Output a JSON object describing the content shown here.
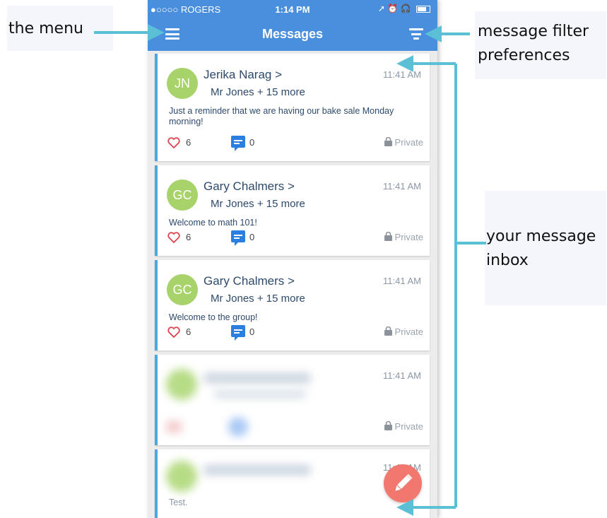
{
  "annotations": {
    "menu": "the menu",
    "filter_line1": "message filter",
    "filter_line2": "preferences",
    "inbox_line1": "your message",
    "inbox_line2": "inbox"
  },
  "status_bar": {
    "carrier": "●○○○○ ROGERS",
    "time": "1:14 PM"
  },
  "header": {
    "title": "Messages",
    "menu_icon": "hamburger-icon",
    "filter_icon": "filter-icon"
  },
  "messages": [
    {
      "initials": "JN",
      "sender": "Jerika Narag >",
      "recipients": "Mr Jones + 15 more",
      "time": "11:41 AM",
      "body": "Just a reminder that we are having our bake sale Monday morning!",
      "likes": "6",
      "comments": "0",
      "privacy": "Private"
    },
    {
      "initials": "GC",
      "sender": "Gary Chalmers >",
      "recipients": "Mr Jones + 15 more",
      "time": "11:41 AM",
      "body": "Welcome to math 101!",
      "likes": "6",
      "comments": "0",
      "privacy": "Private"
    },
    {
      "initials": "GC",
      "sender": "Gary Chalmers >",
      "recipients": "Mr Jones + 15 more",
      "time": "11:41 AM",
      "body": "Welcome to the group!",
      "likes": "6",
      "comments": "0",
      "privacy": "Private"
    },
    {
      "time": "11:41 AM",
      "privacy": "Private"
    },
    {
      "time": "11:41 AM",
      "body": "Test."
    }
  ],
  "colors": {
    "nav_blue": "#4a8fdd",
    "accent_bar": "#4aa8df",
    "avatar_green": "#a8d26a",
    "heart_red": "#e0434c",
    "comment_blue": "#2b7fe0",
    "fab_red": "#f2776e",
    "arrow_teal": "#5bbfd6"
  },
  "fab_icon": "pencil-icon"
}
